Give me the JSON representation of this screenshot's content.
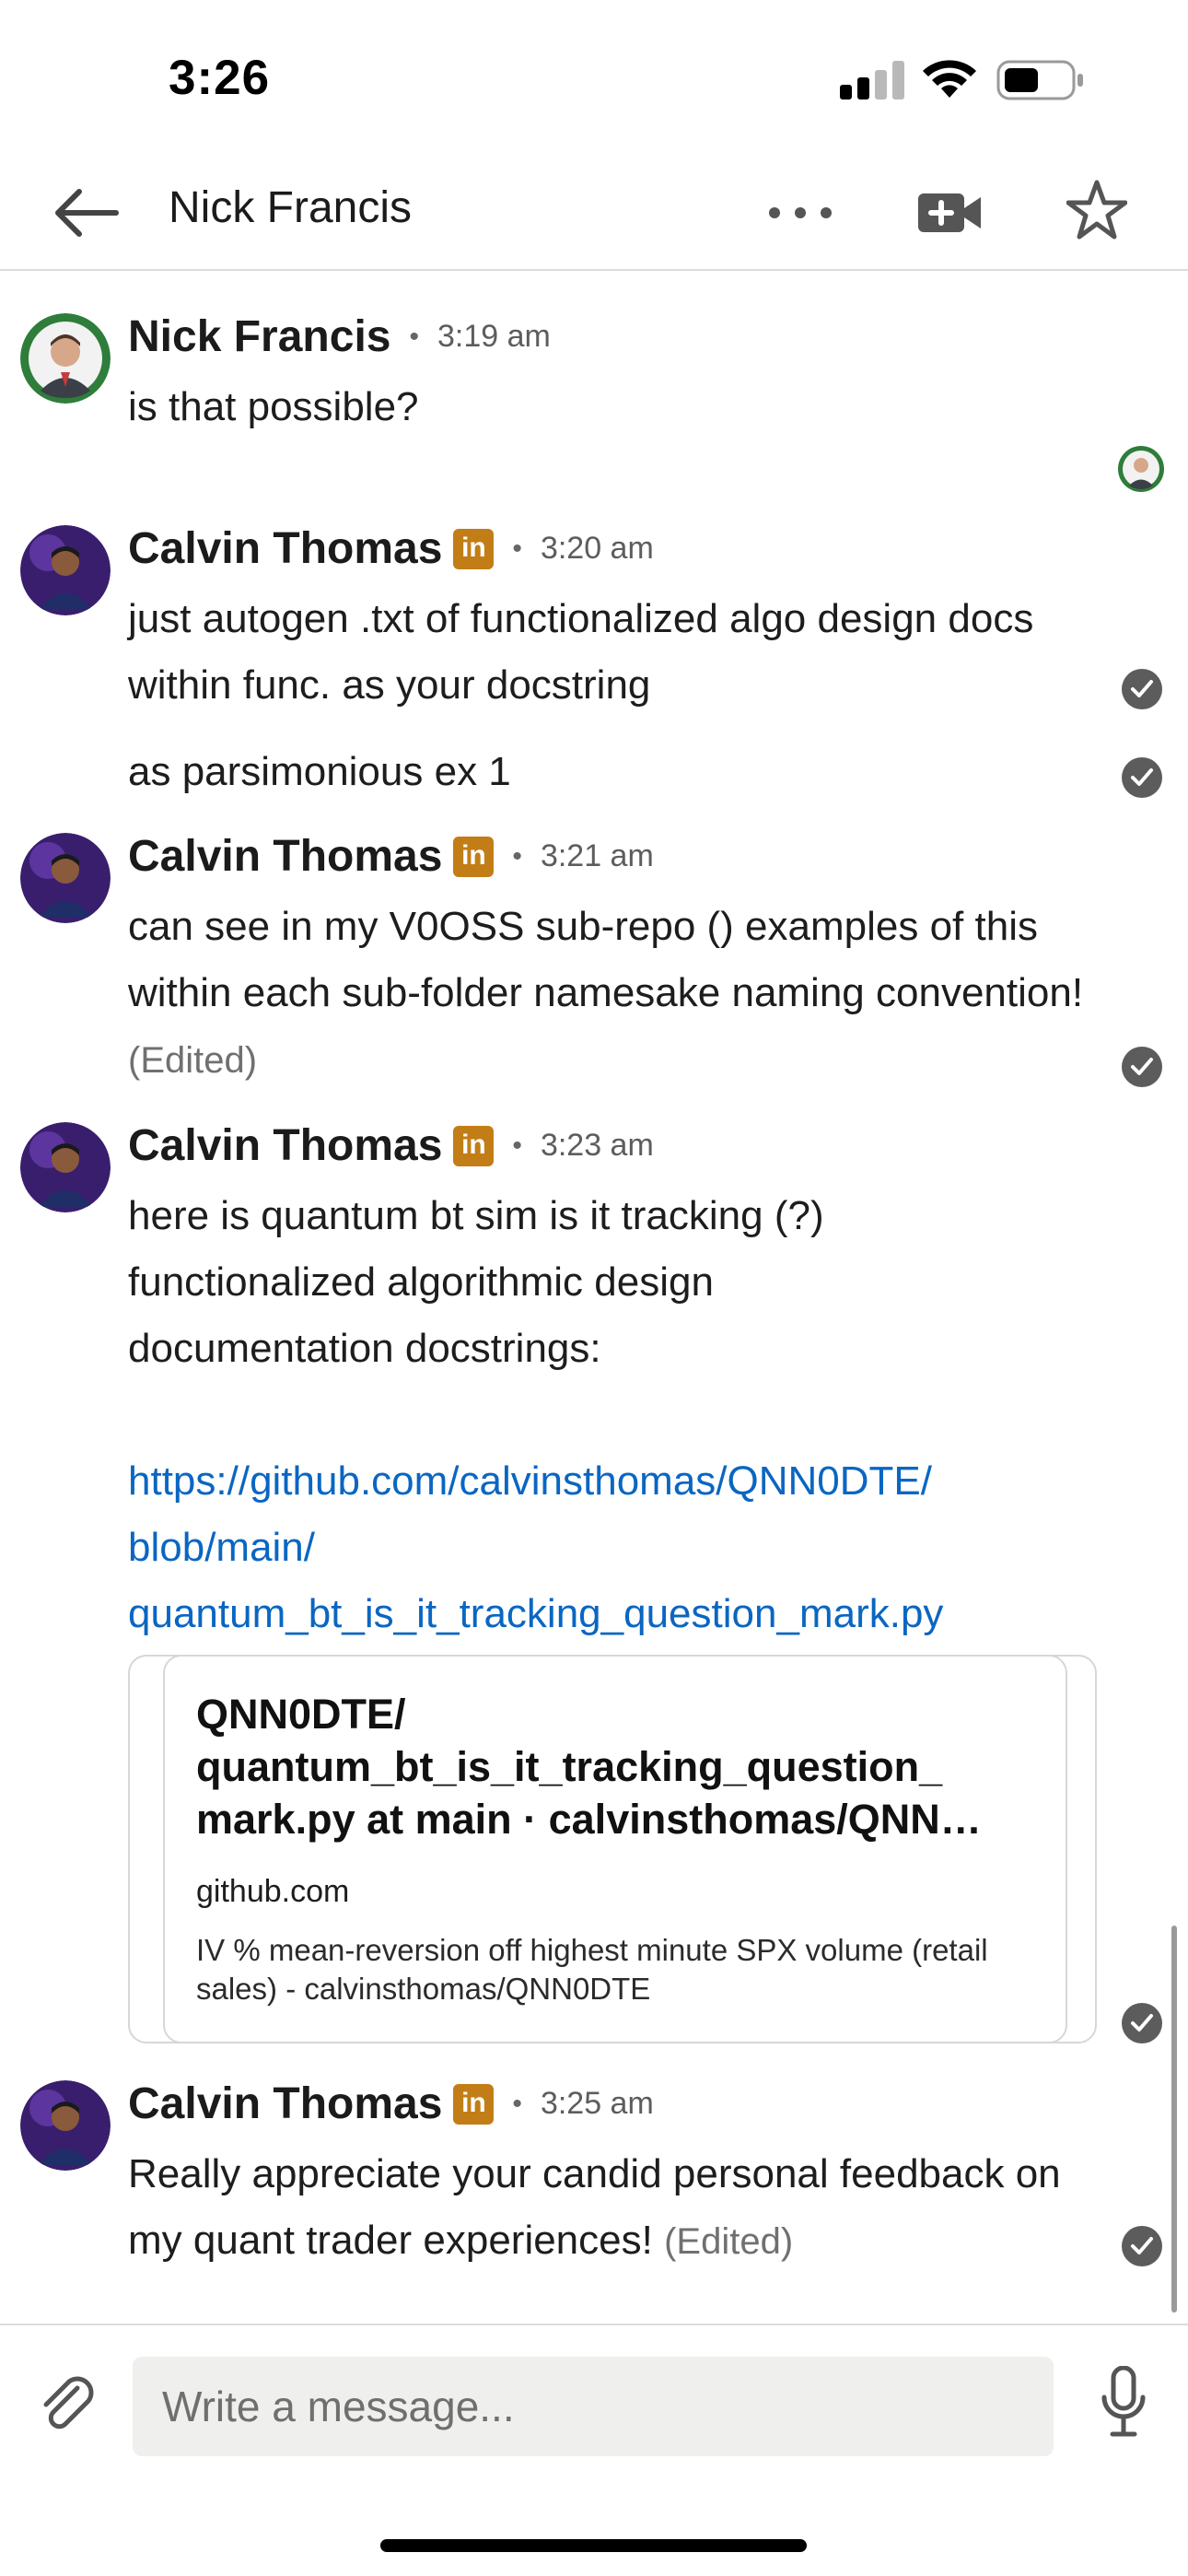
{
  "status_bar": {
    "time": "3:26"
  },
  "header": {
    "title": "Nick Francis"
  },
  "messages": [
    {
      "sender": "Nick Francis",
      "time": "3:19 am",
      "texts": [
        "is that possible?"
      ]
    },
    {
      "sender": "Calvin Thomas",
      "time": "3:20 am",
      "texts": [
        "just autogen .txt of functionalized algo design docs within func. as your docstring",
        "as parsimonious ex 1"
      ]
    },
    {
      "sender": "Calvin Thomas",
      "time": "3:21 am",
      "texts": [
        "can see in my V0OSS  sub-repo () examples of this within each sub-folder namesake naming convention!"
      ],
      "edited": "(Edited)"
    },
    {
      "sender": "Calvin Thomas",
      "time": "3:23 am",
      "texts": [
        "here is quantum bt sim is it tracking (?) functionalized algorithmic design documentation docstrings:"
      ],
      "link": "https://github.com/calvinsthomas/QNN0DTE/blob/main/quantum_bt_is_it_tracking_question_mark.py",
      "link_lines": [
        "https://github.com/calvinsthomas/QNN0DTE/",
        "blob/main/",
        "quantum_bt_is_it_tracking_question_mark.py"
      ],
      "preview": {
        "title": "QNN0DTE/ quantum_bt_is_it_tracking_question_ mark.py at main · calvinsthomas/QNN…",
        "domain": "github.com",
        "description": "IV % mean-reversion off highest minute SPX volume (retail sales) - calvinsthomas/QNN0DTE"
      }
    },
    {
      "sender": "Calvin Thomas",
      "time": "3:25 am",
      "texts": [
        "Really appreciate your candid personal feedback on my quant trader experiences!"
      ],
      "edited": "(Edited)"
    }
  ],
  "composer": {
    "placeholder": "Write a message..."
  },
  "icons": {
    "back": "back-arrow-icon",
    "more": "more-icon",
    "video": "video-call-icon",
    "star": "star-icon",
    "linkedin": "linkedin-badge-icon",
    "read": "read-receipt-icon",
    "attach": "paperclip-icon",
    "mic": "microphone-icon"
  },
  "colors": {
    "link": "#0a66c2",
    "linkedin_badge": "#c37d16",
    "input_bg": "#efefed"
  }
}
